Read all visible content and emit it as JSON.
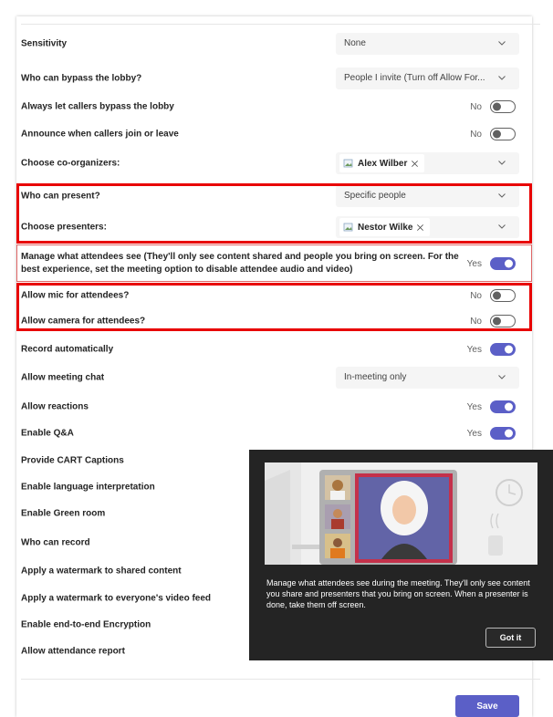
{
  "settings": {
    "sensitivity": {
      "label": "Sensitivity",
      "value": "None"
    },
    "bypass_lobby": {
      "label": "Who can bypass the lobby?",
      "value": "People I invite (Turn off Allow For..."
    },
    "callers_bypass": {
      "label": "Always let callers bypass the lobby",
      "state": "No"
    },
    "announce_callers": {
      "label": "Announce when callers join or leave",
      "state": "No"
    },
    "co_organizers": {
      "label": "Choose co-organizers:",
      "person": "Alex Wilber"
    },
    "who_can_present": {
      "label": "Who can present?",
      "value": "Specific people"
    },
    "presenters": {
      "label": "Choose presenters:",
      "person": "Nestor Wilke"
    },
    "manage_attendees": {
      "label": "Manage what attendees see (They'll only see content shared and people you bring on screen. For the best experience, set the meeting option to disable attendee audio and video)",
      "state": "Yes"
    },
    "mic": {
      "label": "Allow mic for attendees?",
      "state": "No"
    },
    "camera": {
      "label": "Allow camera for attendees?",
      "state": "No"
    },
    "record_auto": {
      "label": "Record automatically",
      "state": "Yes"
    },
    "meeting_chat": {
      "label": "Allow meeting chat",
      "value": "In-meeting only"
    },
    "reactions": {
      "label": "Allow reactions",
      "state": "Yes"
    },
    "qa": {
      "label": "Enable Q&A",
      "state": "Yes"
    },
    "cart": {
      "label": "Provide CART Captions"
    },
    "interpretation": {
      "label": "Enable language interpretation"
    },
    "green_room": {
      "label": "Enable Green room"
    },
    "who_record": {
      "label": "Who can record"
    },
    "watermark_shared": {
      "label": "Apply a watermark to shared content"
    },
    "watermark_video": {
      "label": "Apply a watermark to everyone's video feed"
    },
    "e2e": {
      "label": "Enable end-to-end Encryption"
    },
    "attendance": {
      "label": "Allow attendance report"
    }
  },
  "save_label": "Save",
  "callout": {
    "text": "Manage what attendees see during the meeting. They'll only see content you share and presenters that you bring on screen. When a presenter is done, take them off screen.",
    "button": "Got it"
  },
  "colors": {
    "accent": "#5b5fc7",
    "highlight": "#e80000"
  }
}
